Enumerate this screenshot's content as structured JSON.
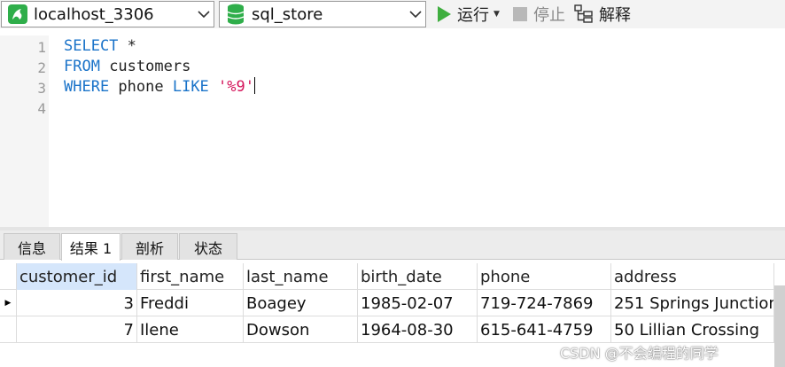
{
  "toolbar": {
    "connection": {
      "label": "localhost_3306",
      "icon": "mysql-dolphin-icon",
      "icon_color": "#2fae4a"
    },
    "database": {
      "label": "sql_store",
      "icon": "database-icon",
      "icon_color": "#2fae4a"
    },
    "run": {
      "label": "运行",
      "icon": "play-icon",
      "color": "#3fae3f"
    },
    "stop": {
      "label": "停止",
      "icon": "stop-icon"
    },
    "explain": {
      "label": "解释",
      "icon": "explain-icon"
    }
  },
  "editor": {
    "line_numbers": [
      "1",
      "2",
      "3",
      "4"
    ],
    "lines": [
      {
        "kw1": "SELECT",
        "text": " *"
      },
      {
        "kw1": "FROM",
        "text": " customers"
      },
      {
        "kw1": "WHERE",
        "text1": " phone ",
        "kw2": "LIKE",
        "text2": " ",
        "str": "'%9'"
      },
      {
        "text": ""
      }
    ]
  },
  "tabs": [
    {
      "label": "信息",
      "active": false
    },
    {
      "label": "结果 1",
      "active": true
    },
    {
      "label": "剖析",
      "active": false
    },
    {
      "label": "状态",
      "active": false
    }
  ],
  "grid": {
    "columns": [
      "customer_id",
      "first_name",
      "last_name",
      "birth_date",
      "phone",
      "address"
    ],
    "rows": [
      [
        "3",
        "Freddi",
        "Boagey",
        "1985-02-07",
        "719-724-7869",
        "251 Springs Junction"
      ],
      [
        "7",
        "Ilene",
        "Dowson",
        "1964-08-30",
        "615-641-4759",
        "50 Lillian Crossing"
      ]
    ],
    "current_row_marker": "▶"
  },
  "watermark": "CSDN @不会编程的同学"
}
